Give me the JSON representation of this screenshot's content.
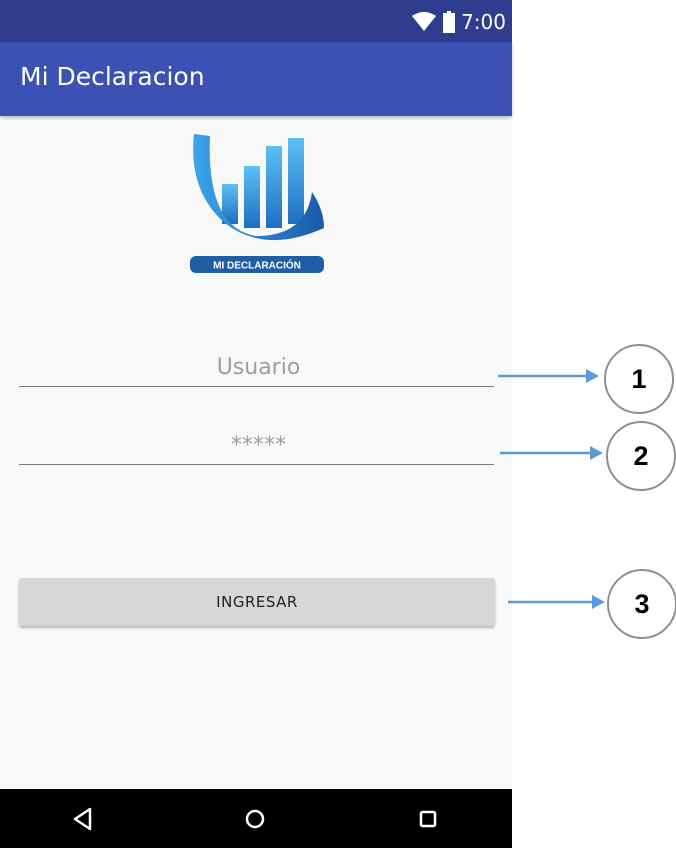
{
  "status_bar": {
    "time": "7:00",
    "icons": [
      "wifi-icon",
      "battery-icon"
    ]
  },
  "app_bar": {
    "title": "Mi Declaracion"
  },
  "logo": {
    "text": "MI DECLARACIÓN"
  },
  "form": {
    "username_placeholder": "Usuario",
    "password_value": "*****",
    "submit_label": "INGRESAR"
  },
  "nav_bar": {
    "icons": [
      "back-icon",
      "home-icon",
      "recents-icon"
    ]
  },
  "callouts": [
    "1",
    "2",
    "3"
  ],
  "colors": {
    "status_bar": "#2f3d8f",
    "app_bar": "#3c51b4",
    "logo_blue": "#2f8fdc",
    "arrow": "#5b9bd5",
    "button": "#d6d7d7"
  }
}
